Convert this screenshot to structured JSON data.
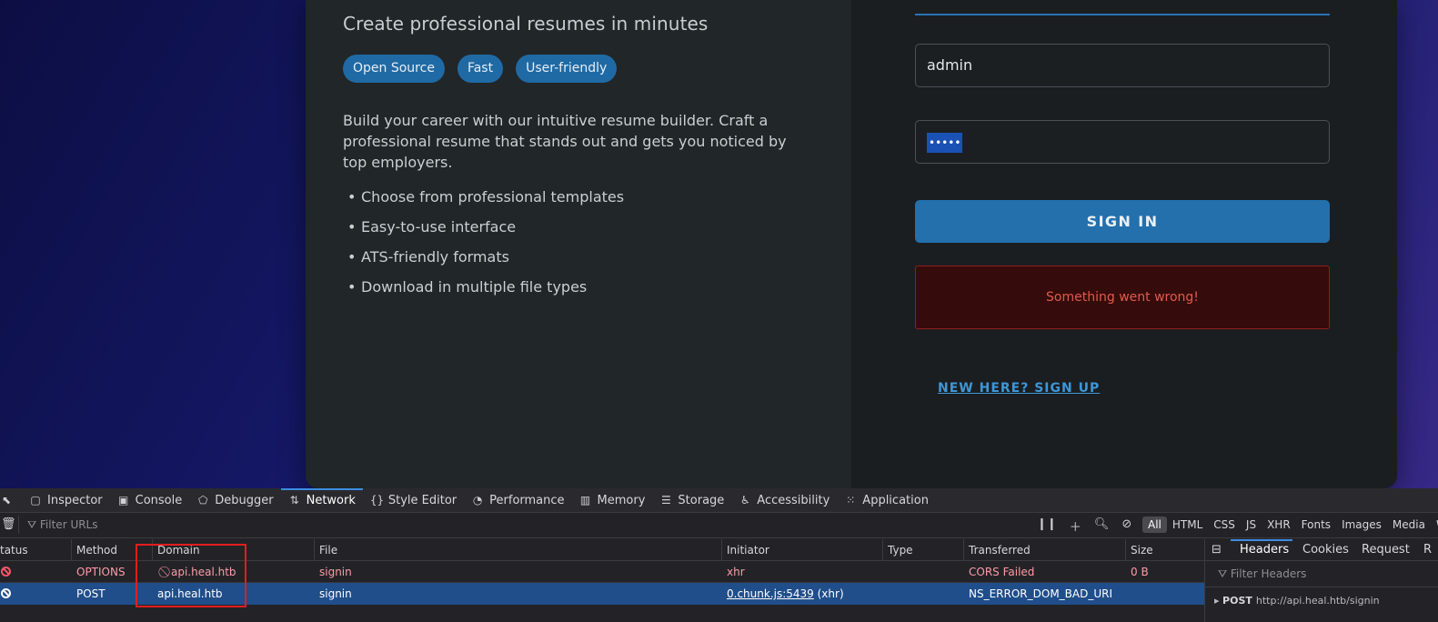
{
  "page": {
    "subtitle": "Create professional resumes in minutes",
    "tags": [
      "Open Source",
      "Fast",
      "User-friendly"
    ],
    "intro": "Build your career with our intuitive resume builder. Craft a professional resume that stands out and gets you noticed by top employers.",
    "features": [
      "Choose from professional templates",
      "Easy-to-use interface",
      "ATS-friendly formats",
      "Download in multiple file types"
    ]
  },
  "login": {
    "username_value": "admin",
    "password_mask": "•••••",
    "signin_label": "SIGN IN",
    "error_message": "Something went wrong!",
    "signup_link": "NEW HERE? SIGN UP"
  },
  "devtools": {
    "tabs": [
      {
        "label": "Inspector",
        "icon": "inspector-icon"
      },
      {
        "label": "Console",
        "icon": "console-icon"
      },
      {
        "label": "Debugger",
        "icon": "debugger-icon"
      },
      {
        "label": "Network",
        "icon": "network-icon"
      },
      {
        "label": "Style Editor",
        "icon": "style-editor-icon"
      },
      {
        "label": "Performance",
        "icon": "performance-icon"
      },
      {
        "label": "Memory",
        "icon": "memory-icon"
      },
      {
        "label": "Storage",
        "icon": "storage-icon"
      },
      {
        "label": "Accessibility",
        "icon": "accessibility-icon"
      },
      {
        "label": "Application",
        "icon": "application-icon"
      }
    ],
    "active_tab": "Network",
    "filter_placeholder": "Filter URLs",
    "type_filters": [
      "All",
      "HTML",
      "CSS",
      "JS",
      "XHR",
      "Fonts",
      "Images",
      "Media",
      "WS"
    ],
    "columns": [
      "tatus",
      "Method",
      "Domain",
      "File",
      "Initiator",
      "Type",
      "Transferred",
      "Size"
    ],
    "rows": [
      {
        "method": "OPTIONS",
        "domain": "api.heal.htb",
        "file": "signin",
        "initiator": "xhr",
        "initiator_suffix": "",
        "type": "",
        "transferred": "CORS Failed",
        "size": "0 B"
      },
      {
        "method": "POST",
        "domain": "api.heal.htb",
        "file": "signin",
        "initiator": "0.chunk.js:5439",
        "initiator_suffix": "(xhr)",
        "type": "",
        "transferred": "NS_ERROR_DOM_BAD_URI",
        "size": ""
      }
    ],
    "side_panel": {
      "tabs": [
        "Headers",
        "Cookies",
        "Request",
        "R"
      ],
      "filter_placeholder": "Filter Headers",
      "request_method": "POST",
      "request_url": "http://api.heal.htb/signin"
    }
  }
}
